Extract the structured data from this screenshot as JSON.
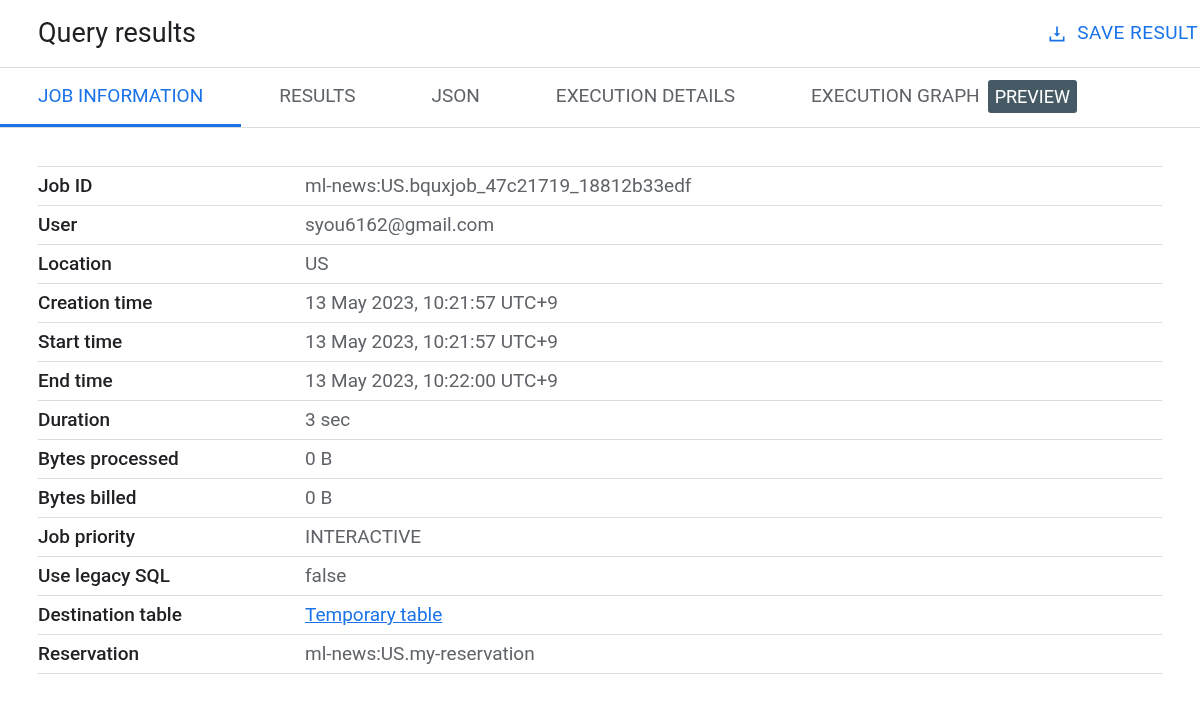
{
  "header": {
    "title": "Query results",
    "action": "SAVE RESULT"
  },
  "tabs": [
    {
      "label": "JOB INFORMATION",
      "selected": true
    },
    {
      "label": "RESULTS",
      "selected": false
    },
    {
      "label": "JSON",
      "selected": false
    },
    {
      "label": "EXECUTION DETAILS",
      "selected": false
    },
    {
      "label": "EXECUTION GRAPH",
      "selected": false,
      "badge": "PREVIEW"
    }
  ],
  "details": [
    {
      "label": "Job ID",
      "value": "ml-news:US.bquxjob_47c21719_18812b33edf",
      "kind": "text"
    },
    {
      "label": "User",
      "value": "syou6162@gmail.com",
      "kind": "text"
    },
    {
      "label": "Location",
      "value": "US",
      "kind": "text"
    },
    {
      "label": "Creation time",
      "value": "13 May 2023, 10:21:57 UTC+9",
      "kind": "text"
    },
    {
      "label": "Start time",
      "value": "13 May 2023, 10:21:57 UTC+9",
      "kind": "text"
    },
    {
      "label": "End time",
      "value": "13 May 2023, 10:22:00 UTC+9",
      "kind": "text"
    },
    {
      "label": "Duration",
      "value": "3 sec",
      "kind": "text"
    },
    {
      "label": "Bytes processed",
      "value": "0 B",
      "kind": "text"
    },
    {
      "label": "Bytes billed",
      "value": "0 B",
      "kind": "text"
    },
    {
      "label": "Job priority",
      "value": "INTERACTIVE",
      "kind": "text"
    },
    {
      "label": "Use legacy SQL",
      "value": "false",
      "kind": "text"
    },
    {
      "label": "Destination table",
      "value": "Temporary table",
      "kind": "link"
    },
    {
      "label": "Reservation",
      "value": "ml-news:US.my-reservation",
      "kind": "text"
    }
  ]
}
